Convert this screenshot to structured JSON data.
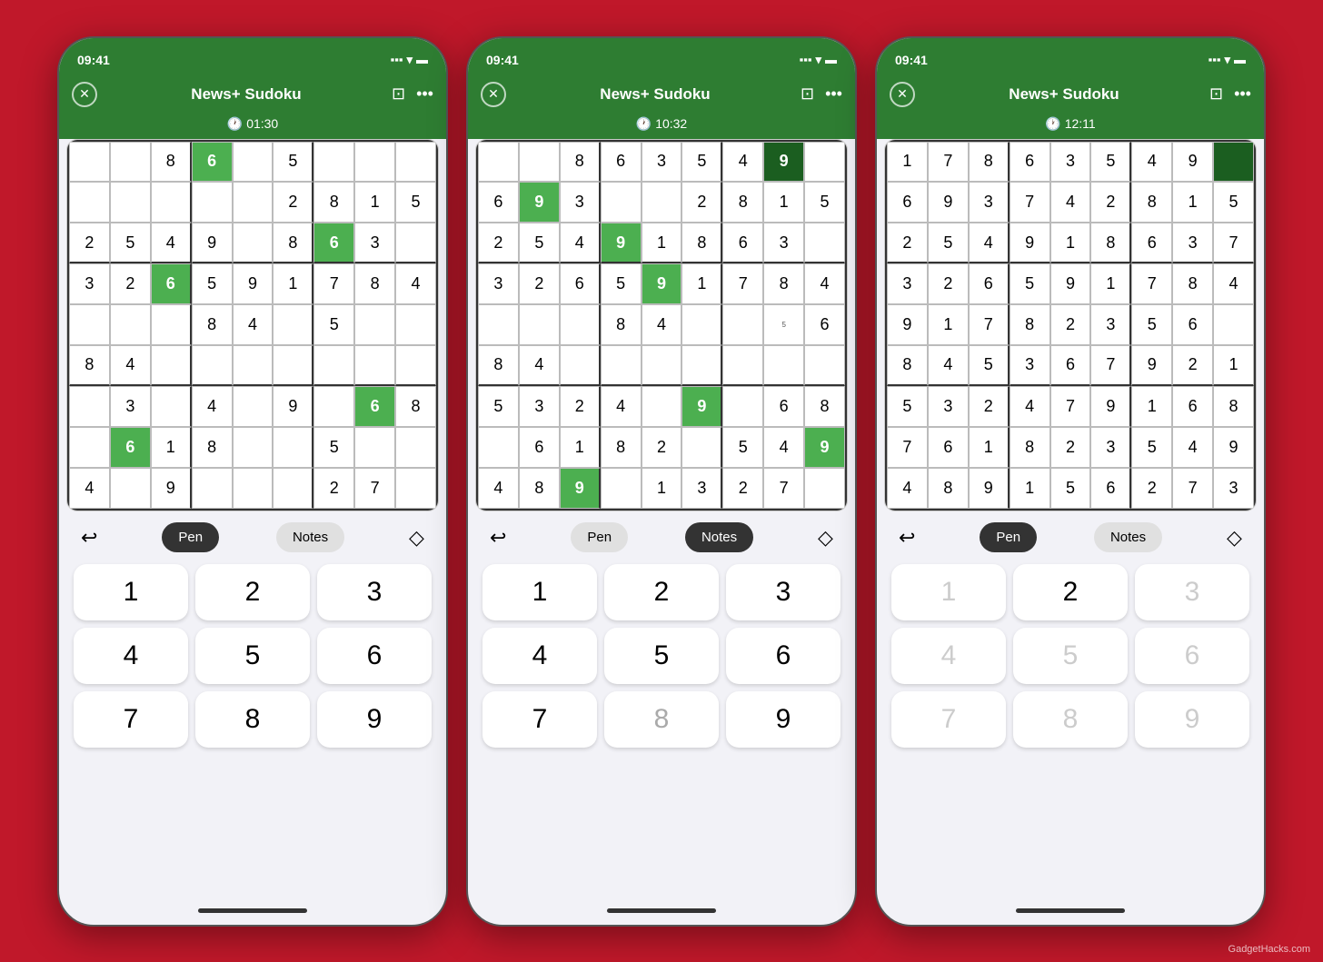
{
  "watermark": "GadgetHacks.com",
  "phones": [
    {
      "id": "phone1",
      "statusBar": {
        "time": "09:41",
        "signal": "▪▪▪",
        "wifi": "wifi",
        "battery": "battery"
      },
      "navTitle": "News+ Sudoku",
      "timer": "01:30",
      "activeMode": "Pen",
      "grid": [
        [
          " ",
          " ",
          "8",
          "6",
          " ",
          "5",
          " ",
          " ",
          " "
        ],
        [
          " ",
          " ",
          " ",
          " ",
          " ",
          "2",
          "8",
          "1",
          "5"
        ],
        [
          "2",
          "5",
          "4",
          "9",
          " ",
          "8",
          "6",
          "3",
          " "
        ],
        [
          "3",
          "2",
          "6",
          "5",
          "9",
          "1",
          "7",
          "8",
          "4"
        ],
        [
          " ",
          " ",
          " ",
          "8",
          "4",
          " ",
          "5",
          " ",
          " "
        ],
        [
          "8",
          "4",
          " ",
          " ",
          " ",
          " ",
          " ",
          " ",
          " "
        ],
        [
          " ",
          "3",
          " ",
          "4",
          " ",
          "9",
          " ",
          "6",
          "8"
        ],
        [
          " ",
          "6",
          "1",
          "8",
          " ",
          " ",
          "5",
          " ",
          " "
        ],
        [
          "4",
          " ",
          "9",
          " ",
          " ",
          " ",
          "2",
          "7",
          " "
        ]
      ],
      "cellTypes": [
        [
          "given",
          "given",
          "given",
          "highlighted",
          "given",
          "given",
          "given",
          "given",
          "given"
        ],
        [
          "given",
          "given",
          "given",
          "given",
          "given",
          "given",
          "given",
          "given",
          "given"
        ],
        [
          "given",
          "given",
          "given",
          "given",
          "given",
          "given",
          "highlighted",
          "given",
          "given"
        ],
        [
          "given",
          "given",
          "highlighted",
          "given",
          "given",
          "given",
          "given",
          "given",
          "given"
        ],
        [
          "given",
          "given",
          "given",
          "given",
          "given",
          "given",
          "given",
          "given",
          "given"
        ],
        [
          "given",
          "given",
          "given",
          "given",
          "given",
          "given",
          "given",
          "given",
          "given"
        ],
        [
          "given",
          "given",
          "given",
          "given",
          "given",
          "given",
          "given",
          "highlighted",
          "given"
        ],
        [
          "given",
          "highlighted",
          "given",
          "given",
          "given",
          "given",
          "given",
          "given",
          "given"
        ],
        [
          "given",
          "given",
          "given",
          "given",
          "given",
          "given",
          "given",
          "given",
          "given"
        ]
      ],
      "numpad": {
        "keys": [
          "1",
          "2",
          "3",
          "4",
          "5",
          "6",
          "7",
          "8",
          "9"
        ],
        "dimmed": []
      }
    },
    {
      "id": "phone2",
      "statusBar": {
        "time": "09:41",
        "signal": "▪▪▪",
        "wifi": "wifi",
        "battery": "battery"
      },
      "navTitle": "News+ Sudoku",
      "timer": "10:32",
      "activeMode": "Notes",
      "grid": [
        [
          " ",
          " ",
          "8",
          "6",
          "3",
          "5",
          "4",
          "9",
          " "
        ],
        [
          "6",
          "9",
          "3",
          " ",
          " ",
          "2",
          "8",
          "1",
          "5"
        ],
        [
          "2",
          "5",
          "4",
          "9",
          "1",
          "8",
          "6",
          "3",
          " "
        ],
        [
          "3",
          "2",
          "6",
          "5",
          "9",
          "1",
          "7",
          "8",
          "4"
        ],
        [
          " ",
          " ",
          " ",
          "8",
          "4",
          " ",
          " ",
          "5",
          "6"
        ],
        [
          "8",
          "4",
          " ",
          " ",
          " ",
          " ",
          " ",
          " ",
          " "
        ],
        [
          "5",
          "3",
          "2",
          "4",
          " ",
          "9",
          " ",
          "6",
          "8"
        ],
        [
          " ",
          "6",
          "1",
          "8",
          "2",
          " ",
          "5",
          "4",
          "9"
        ],
        [
          "4",
          "8",
          "9",
          " ",
          "1",
          "3",
          "2",
          "7",
          " "
        ]
      ],
      "cellTypes": [
        [
          "given",
          "given",
          "given",
          "given",
          "given",
          "given",
          "given",
          "dark-green",
          "given"
        ],
        [
          "given",
          "highlighted",
          "given",
          "given",
          "given",
          "given",
          "given",
          "given",
          "given"
        ],
        [
          "given",
          "given",
          "given",
          "highlighted",
          "given",
          "given",
          "given",
          "given",
          "given"
        ],
        [
          "given",
          "given",
          "given",
          "given",
          "highlighted",
          "given",
          "given",
          "given",
          "given"
        ],
        [
          "given",
          "given",
          "given",
          "given",
          "given",
          "given",
          "given",
          "given",
          "given"
        ],
        [
          "given",
          "given",
          "given",
          "given",
          "given",
          "given",
          "given",
          "given",
          "given"
        ],
        [
          "given",
          "given",
          "given",
          "given",
          "given",
          "highlighted",
          "given",
          "given",
          "given"
        ],
        [
          "given",
          "given",
          "given",
          "given",
          "given",
          "given",
          "given",
          "given",
          "highlighted"
        ],
        [
          "given",
          "given",
          "highlighted",
          "given",
          "given",
          "given",
          "given",
          "given",
          "given"
        ]
      ],
      "hasNotes": true,
      "numpad": {
        "keys": [
          "1",
          "2",
          "3",
          "4",
          "5",
          "6",
          "7",
          "8",
          "9"
        ],
        "dimmed": [
          "8"
        ]
      }
    },
    {
      "id": "phone3",
      "statusBar": {
        "time": "09:41",
        "signal": "▪▪▪",
        "wifi": "wifi",
        "battery": "battery"
      },
      "navTitle": "News+ Sudoku",
      "timer": "12:11",
      "activeMode": "Pen",
      "grid": [
        [
          "1",
          "7",
          "8",
          "6",
          "3",
          "5",
          "4",
          "9",
          " "
        ],
        [
          "6",
          "9",
          "3",
          "7",
          "4",
          "2",
          "8",
          "1",
          "5"
        ],
        [
          "2",
          "5",
          "4",
          "9",
          "1",
          "8",
          "6",
          "3",
          "7"
        ],
        [
          "3",
          "2",
          "6",
          "5",
          "9",
          "1",
          "7",
          "8",
          "4"
        ],
        [
          "9",
          "1",
          "7",
          "8",
          "2",
          "3",
          "5",
          "6",
          " "
        ],
        [
          "8",
          "4",
          "5",
          "3",
          "6",
          "7",
          "9",
          "2",
          "1"
        ],
        [
          "5",
          "3",
          "2",
          "4",
          "7",
          "9",
          "1",
          "6",
          "8"
        ],
        [
          "7",
          "6",
          "1",
          "8",
          "2",
          "3",
          "5",
          "4",
          "9"
        ],
        [
          "4",
          "8",
          "9",
          "1",
          "5",
          "6",
          "2",
          "7",
          "3"
        ]
      ],
      "cellTypes": [
        [
          "given",
          "given",
          "given",
          "given",
          "given",
          "given",
          "given",
          "given",
          "dark-green"
        ],
        [
          "given",
          "given",
          "given",
          "given",
          "given",
          "given",
          "given",
          "given",
          "given"
        ],
        [
          "given",
          "given",
          "given",
          "given",
          "given",
          "given",
          "given",
          "given",
          "given"
        ],
        [
          "given",
          "given",
          "given",
          "given",
          "given",
          "given",
          "given",
          "given",
          "given"
        ],
        [
          "given",
          "given",
          "given",
          "given",
          "given",
          "given",
          "given",
          "given",
          "given"
        ],
        [
          "given",
          "given",
          "given",
          "given",
          "given",
          "given",
          "given",
          "given",
          "given"
        ],
        [
          "given",
          "given",
          "given",
          "given",
          "given",
          "given",
          "given",
          "given",
          "given"
        ],
        [
          "given",
          "given",
          "given",
          "given",
          "given",
          "given",
          "given",
          "given",
          "given"
        ],
        [
          "given",
          "given",
          "given",
          "given",
          "given",
          "given",
          "given",
          "given",
          "given"
        ]
      ],
      "numpad": {
        "keys": [
          "1",
          "2",
          "3",
          "4",
          "5",
          "6",
          "7",
          "8",
          "9"
        ],
        "dimmed": [
          "1",
          "3",
          "4",
          "5",
          "6",
          "7",
          "8",
          "9"
        ]
      }
    }
  ],
  "controls": {
    "undoLabel": "↩",
    "penLabel": "Pen",
    "notesLabel": "Notes",
    "eraseLabel": "◇"
  }
}
